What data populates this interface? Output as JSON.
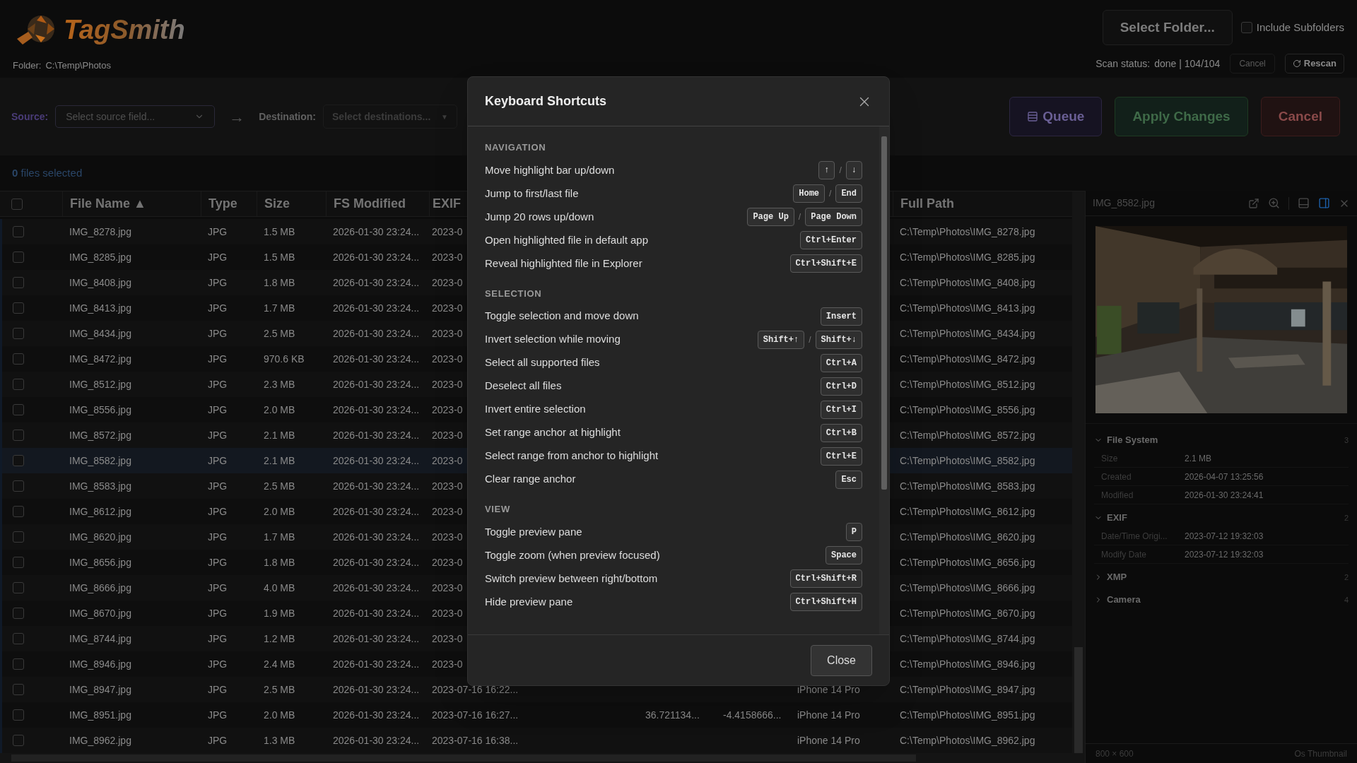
{
  "header": {
    "logo": "TagSmith",
    "folder_label": "Folder:",
    "folder": "C:\\Temp\\Photos",
    "select_folder": "Select Folder...",
    "include_subfolders": {
      "label": "Include Subfolders",
      "checked": false
    },
    "scan_label": "Scan status:",
    "scan_value": "done | 104/104",
    "scan_cancel": {
      "label": "Cancel",
      "disabled": true
    },
    "rescan": {
      "label": "Rescan",
      "disabled": false
    }
  },
  "toolbar": {
    "source_label": "Source:",
    "source_placeholder": "Select source field...",
    "arrow": "→",
    "destination_label": "Destination:",
    "destination_placeholder": "Select destinations...",
    "destination_caret": "▼",
    "buttons": [
      {
        "kind": "queue",
        "label": "Queue"
      },
      {
        "kind": "apply",
        "label": "Apply Changes"
      },
      {
        "kind": "cancel",
        "label": "Cancel"
      }
    ]
  },
  "selection_summary": "**0** files selected",
  "table": {
    "select_all": {
      "checked": false
    },
    "columns": [
      "File Name ▲",
      "Type",
      "Size",
      "FS Modified",
      "EXIF",
      "",
      "",
      "",
      "",
      "Full Path"
    ],
    "rows": [
      {
        "checked": false,
        "selected": false,
        "cells": [
          "IMG_8278.jpg",
          "JPG",
          "1.5 MB",
          "2026-01-30 23:24...",
          "2023-0"
        ],
        "full_path": "C:\\Temp\\Photos\\IMG_8278.jpg"
      },
      {
        "checked": false,
        "selected": false,
        "cells": [
          "IMG_8285.jpg",
          "JPG",
          "1.5 MB",
          "2026-01-30 23:24...",
          "2023-0"
        ],
        "full_path": "C:\\Temp\\Photos\\IMG_8285.jpg"
      },
      {
        "checked": false,
        "selected": false,
        "cells": [
          "IMG_8408.jpg",
          "JPG",
          "1.8 MB",
          "2026-01-30 23:24...",
          "2023-0"
        ],
        "full_path": "C:\\Temp\\Photos\\IMG_8408.jpg"
      },
      {
        "checked": false,
        "selected": false,
        "cells": [
          "IMG_8413.jpg",
          "JPG",
          "1.7 MB",
          "2026-01-30 23:24...",
          "2023-0"
        ],
        "full_path": "C:\\Temp\\Photos\\IMG_8413.jpg"
      },
      {
        "checked": false,
        "selected": false,
        "cells": [
          "IMG_8434.jpg",
          "JPG",
          "2.5 MB",
          "2026-01-30 23:24...",
          "2023-0"
        ],
        "full_path": "C:\\Temp\\Photos\\IMG_8434.jpg"
      },
      {
        "checked": false,
        "selected": false,
        "cells": [
          "IMG_8472.jpg",
          "JPG",
          "970.6 KB",
          "2026-01-30 23:24...",
          "2023-0"
        ],
        "full_path": "C:\\Temp\\Photos\\IMG_8472.jpg"
      },
      {
        "checked": false,
        "selected": false,
        "cells": [
          "IMG_8512.jpg",
          "JPG",
          "2.3 MB",
          "2026-01-30 23:24...",
          "2023-0"
        ],
        "full_path": "C:\\Temp\\Photos\\IMG_8512.jpg"
      },
      {
        "checked": false,
        "selected": false,
        "cells": [
          "IMG_8556.jpg",
          "JPG",
          "2.0 MB",
          "2026-01-30 23:24...",
          "2023-0"
        ],
        "full_path": "C:\\Temp\\Photos\\IMG_8556.jpg"
      },
      {
        "checked": false,
        "selected": false,
        "cells": [
          "IMG_8572.jpg",
          "JPG",
          "2.1 MB",
          "2026-01-30 23:24...",
          "2023-0"
        ],
        "full_path": "C:\\Temp\\Photos\\IMG_8572.jpg"
      },
      {
        "checked": false,
        "selected": true,
        "cells": [
          "IMG_8582.jpg",
          "JPG",
          "2.1 MB",
          "2026-01-30 23:24...",
          "2023-0"
        ],
        "full_path": "C:\\Temp\\Photos\\IMG_8582.jpg"
      },
      {
        "checked": false,
        "selected": false,
        "cells": [
          "IMG_8583.jpg",
          "JPG",
          "2.5 MB",
          "2026-01-30 23:24...",
          "2023-0"
        ],
        "full_path": "C:\\Temp\\Photos\\IMG_8583.jpg"
      },
      {
        "checked": false,
        "selected": false,
        "cells": [
          "IMG_8612.jpg",
          "JPG",
          "2.0 MB",
          "2026-01-30 23:24...",
          "2023-0"
        ],
        "full_path": "C:\\Temp\\Photos\\IMG_8612.jpg"
      },
      {
        "checked": false,
        "selected": false,
        "cells": [
          "IMG_8620.jpg",
          "JPG",
          "1.7 MB",
          "2026-01-30 23:24...",
          "2023-0"
        ],
        "full_path": "C:\\Temp\\Photos\\IMG_8620.jpg"
      },
      {
        "checked": false,
        "selected": false,
        "cells": [
          "IMG_8656.jpg",
          "JPG",
          "1.8 MB",
          "2026-01-30 23:24...",
          "2023-0"
        ],
        "full_path": "C:\\Temp\\Photos\\IMG_8656.jpg"
      },
      {
        "checked": false,
        "selected": false,
        "cells": [
          "IMG_8666.jpg",
          "JPG",
          "4.0 MB",
          "2026-01-30 23:24...",
          "2023-0"
        ],
        "full_path": "C:\\Temp\\Photos\\IMG_8666.jpg"
      },
      {
        "checked": false,
        "selected": false,
        "cells": [
          "IMG_8670.jpg",
          "JPG",
          "1.9 MB",
          "2026-01-30 23:24...",
          "2023-0"
        ],
        "full_path": "C:\\Temp\\Photos\\IMG_8670.jpg"
      },
      {
        "checked": false,
        "selected": false,
        "cells": [
          "IMG_8744.jpg",
          "JPG",
          "1.2 MB",
          "2026-01-30 23:24...",
          "2023-0"
        ],
        "full_path": "C:\\Temp\\Photos\\IMG_8744.jpg"
      },
      {
        "checked": false,
        "selected": false,
        "cells": [
          "IMG_8946.jpg",
          "JPG",
          "2.4 MB",
          "2026-01-30 23:24...",
          "2023-0"
        ],
        "full_path": "C:\\Temp\\Photos\\IMG_8946.jpg"
      },
      {
        "checked": false,
        "selected": false,
        "cells": [
          "IMG_8947.jpg",
          "JPG",
          "2.5 MB",
          "2026-01-30 23:24...",
          "2023-07-16 16:22...",
          "",
          "",
          "",
          "iPhone 14 Pro"
        ],
        "full_path": "C:\\Temp\\Photos\\IMG_8947.jpg"
      },
      {
        "checked": false,
        "selected": false,
        "cells": [
          "IMG_8951.jpg",
          "JPG",
          "2.0 MB",
          "2026-01-30 23:24...",
          "2023-07-16 16:27...",
          "",
          "36.721134...",
          "-4.4158666...",
          "iPhone 14 Pro"
        ],
        "full_path": "C:\\Temp\\Photos\\IMG_8951.jpg"
      },
      {
        "checked": false,
        "selected": false,
        "cells": [
          "IMG_8962.jpg",
          "JPG",
          "1.3 MB",
          "2026-01-30 23:24...",
          "2023-07-16 16:38...",
          "",
          "",
          "",
          "iPhone 14 Pro"
        ],
        "full_path": "C:\\Temp\\Photos\\IMG_8962.jpg"
      }
    ]
  },
  "preview": {
    "file_name": "IMG_8582.jpg",
    "layout_buttons": [
      {
        "kind": "bottom",
        "selected": false
      },
      {
        "kind": "right",
        "selected": true
      }
    ],
    "sections": [
      {
        "title": "File System",
        "count": "3",
        "expanded": true,
        "rows": [
          {
            "label": "Size",
            "value": "2.1 MB"
          },
          {
            "label": "Created",
            "value": "2026-04-07 13:25:56"
          },
          {
            "label": "Modified",
            "value": "2026-01-30 23:24:41"
          }
        ]
      },
      {
        "title": "EXIF",
        "count": "2",
        "expanded": true,
        "rows": [
          {
            "label": "Date/Time Origi...",
            "value": "2023-07-12 19:32:03"
          },
          {
            "label": "Modify Date",
            "value": "2023-07-12 19:32:03"
          }
        ]
      },
      {
        "title": "XMP",
        "count": "2",
        "expanded": false
      },
      {
        "title": "Camera",
        "count": "4",
        "expanded": false
      }
    ],
    "dimensions": "800 × 600",
    "source": "Os Thumbnail"
  },
  "dialog": {
    "title": "Keyboard Shortcuts",
    "sections": [
      {
        "title": "NAVIGATION",
        "items": [
          {
            "label": "Move highlight bar up/down",
            "keys": [
              "↑",
              "↓"
            ],
            "separator": "/"
          },
          {
            "label": "Jump to first/last file",
            "keys": [
              "Home",
              "End"
            ],
            "separator": "/"
          },
          {
            "label": "Jump 20 rows up/down",
            "keys": [
              "Page Up",
              "Page Down"
            ],
            "separator": "/"
          },
          {
            "label": "Open highlighted file in default app",
            "keys": [
              "Ctrl+Enter"
            ]
          },
          {
            "label": "Reveal highlighted file in Explorer",
            "keys": [
              "Ctrl+Shift+E"
            ]
          }
        ]
      },
      {
        "title": "SELECTION",
        "items": [
          {
            "label": "Toggle selection and move down",
            "keys": [
              "Insert"
            ]
          },
          {
            "label": "Invert selection while moving",
            "keys": [
              "Shift+↑",
              "Shift+↓"
            ],
            "separator": "/"
          },
          {
            "label": "Select all supported files",
            "keys": [
              "Ctrl+A"
            ]
          },
          {
            "label": "Deselect all files",
            "keys": [
              "Ctrl+D"
            ]
          },
          {
            "label": "Invert entire selection",
            "keys": [
              "Ctrl+I"
            ]
          },
          {
            "label": "Set range anchor at highlight",
            "keys": [
              "Ctrl+B"
            ]
          },
          {
            "label": "Select range from anchor to highlight",
            "keys": [
              "Ctrl+E"
            ]
          },
          {
            "label": "Clear range anchor",
            "keys": [
              "Esc"
            ]
          }
        ]
      },
      {
        "title": "VIEW",
        "items": [
          {
            "label": "Toggle preview pane",
            "keys": [
              "P"
            ]
          },
          {
            "label": "Toggle zoom (when preview focused)",
            "keys": [
              "Space"
            ]
          },
          {
            "label": "Switch preview between right/bottom",
            "keys": [
              "Ctrl+Shift+R"
            ]
          },
          {
            "label": "Hide preview pane",
            "keys": [
              "Ctrl+Shift+H"
            ]
          }
        ]
      }
    ],
    "close": "Close"
  }
}
